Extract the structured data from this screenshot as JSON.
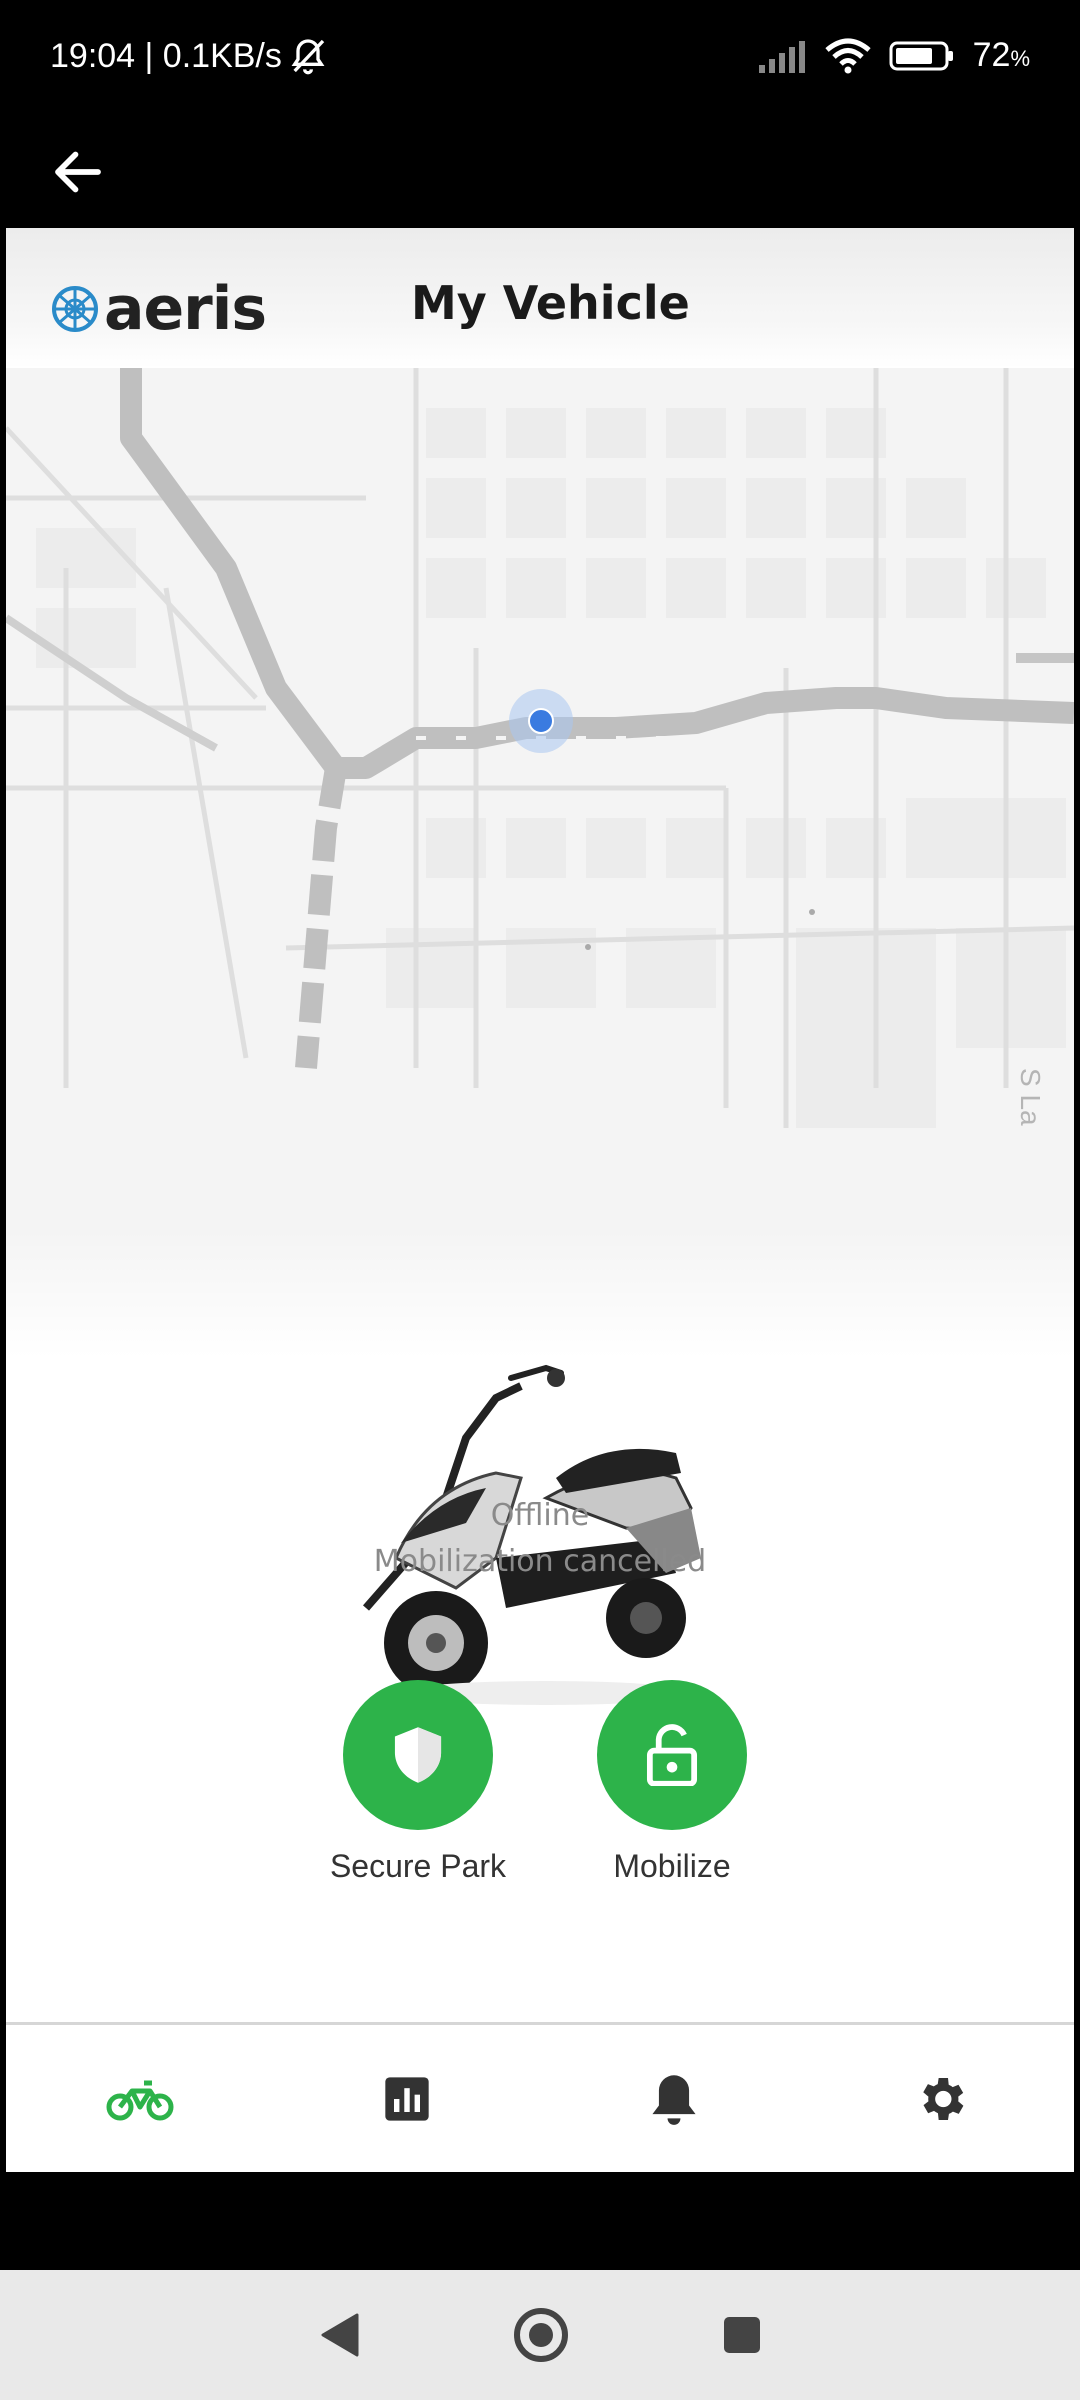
{
  "status_bar": {
    "time_speed": "19:04 | 0.1KB/s",
    "battery_value": "72",
    "battery_unit": "%",
    "icons": [
      "bell-off-icon",
      "signal-icon",
      "wifi-icon",
      "battery-icon"
    ]
  },
  "app_bar": {
    "back_icon": "arrow-left-icon"
  },
  "header": {
    "logo_text": "aeris",
    "title": "My Vehicle"
  },
  "map": {
    "street_label": "S La"
  },
  "vehicle": {
    "status": "Offline",
    "sub_status": "Mobilization cancelled"
  },
  "actions": [
    {
      "label": "Secure Park",
      "icon": "shield-icon"
    },
    {
      "label": "Mobilize",
      "icon": "unlock-icon"
    }
  ],
  "bottom_nav": {
    "items": [
      "bike-icon",
      "bar-chart-icon",
      "bell-icon",
      "gear-icon"
    ],
    "active": "bike-icon",
    "active_color": "#2db34a",
    "inactive_color": "#333333"
  },
  "system_nav": [
    "back-triangle-icon",
    "home-circle-icon",
    "recents-square-icon"
  ]
}
